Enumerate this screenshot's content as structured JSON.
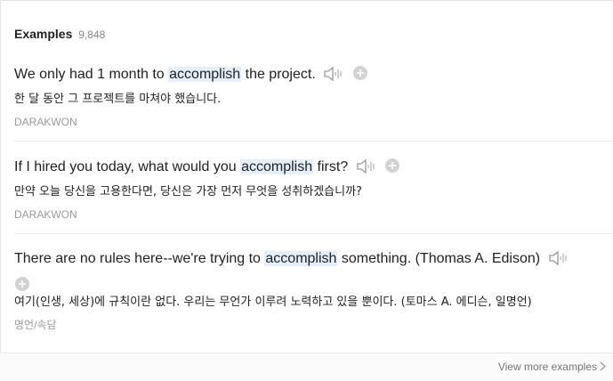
{
  "header": {
    "title": "Examples",
    "count": "9,848"
  },
  "examples": [
    {
      "before": "We only had 1 month to ",
      "keyword": "accomplish",
      "after": " the project.",
      "translation": "한 달 동안 그 프로젝트를 마쳐야 했습니다.",
      "source": "DARAKWON"
    },
    {
      "before": "If I hired you today, what would you ",
      "keyword": "accomplish",
      "after": " first?",
      "translation": "만약 오늘 당신을 고용한다면, 당신은 가장 먼저 무엇을 성취하겠습니까?",
      "source": "DARAKWON"
    },
    {
      "before": "There are no rules here--we're trying to ",
      "keyword": "accomplish",
      "after": " something. (Thomas A. Edison)",
      "translation": "여기(인생, 세상)에 규칙이란 없다. 우리는 무언가 이루려 노력하고 있을 뿐이다. (토마스 A. 에디슨, 일명언)",
      "source": "명언/속담"
    }
  ],
  "footer": {
    "view_more": "View more examples"
  },
  "icons": {
    "speaker": "speaker-icon",
    "add": "plus-circle-icon",
    "chevron": "chevron-right-icon"
  },
  "colors": {
    "highlight": "#e3f0fb",
    "icon_gray": "#bdbdbd"
  }
}
